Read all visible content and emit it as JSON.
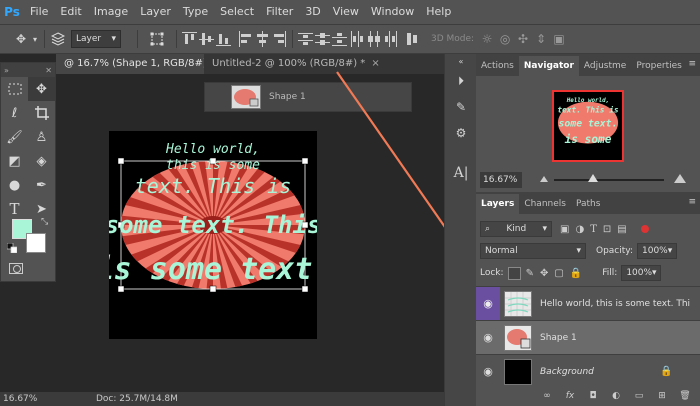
{
  "app": {
    "logo": "Ps"
  },
  "menu": [
    "File",
    "Edit",
    "Image",
    "Layer",
    "Type",
    "Select",
    "Filter",
    "3D",
    "View",
    "Window",
    "Help"
  ],
  "options": {
    "layer_select": "Layer",
    "mode_3d": "3D Mode:"
  },
  "tabs": [
    {
      "label": "@ 16.7% (Shape 1, RGB/8#) *",
      "close": "×"
    },
    {
      "label": "Untitled-2 @ 100% (RGB/8#) *",
      "close": "×"
    }
  ],
  "floating_layer": {
    "label": "Shape 1"
  },
  "artwork": {
    "lines": [
      "Hello world,",
      "this is some",
      "text. This is",
      "some text. This",
      "is some text."
    ],
    "ellipse_color": "#f07a6c",
    "text_color": "#a8f5d8"
  },
  "colors": {
    "foreground": "#a8f5d8",
    "background": "#ffffff",
    "accent_line": "#f07a55"
  },
  "navigator": {
    "tabs": [
      "Actions",
      "Navigator",
      "Adjustme",
      "Properties"
    ],
    "zoom": "16.67%"
  },
  "layers": {
    "tabs": [
      "Layers",
      "Channels",
      "Paths"
    ],
    "kind": "Kind",
    "blend_mode": "Normal",
    "opacity_label": "Opacity:",
    "opacity_value": "100%",
    "lock_label": "Lock:",
    "fill_label": "Fill:",
    "fill_value": "100%",
    "items": [
      {
        "name": "Hello world, this is some text. This is some text"
      },
      {
        "name": "Shape 1"
      },
      {
        "name": "Background"
      }
    ]
  },
  "status": {
    "zoom": "16.67%",
    "doc": "Doc: 25.7M/14.8M"
  }
}
